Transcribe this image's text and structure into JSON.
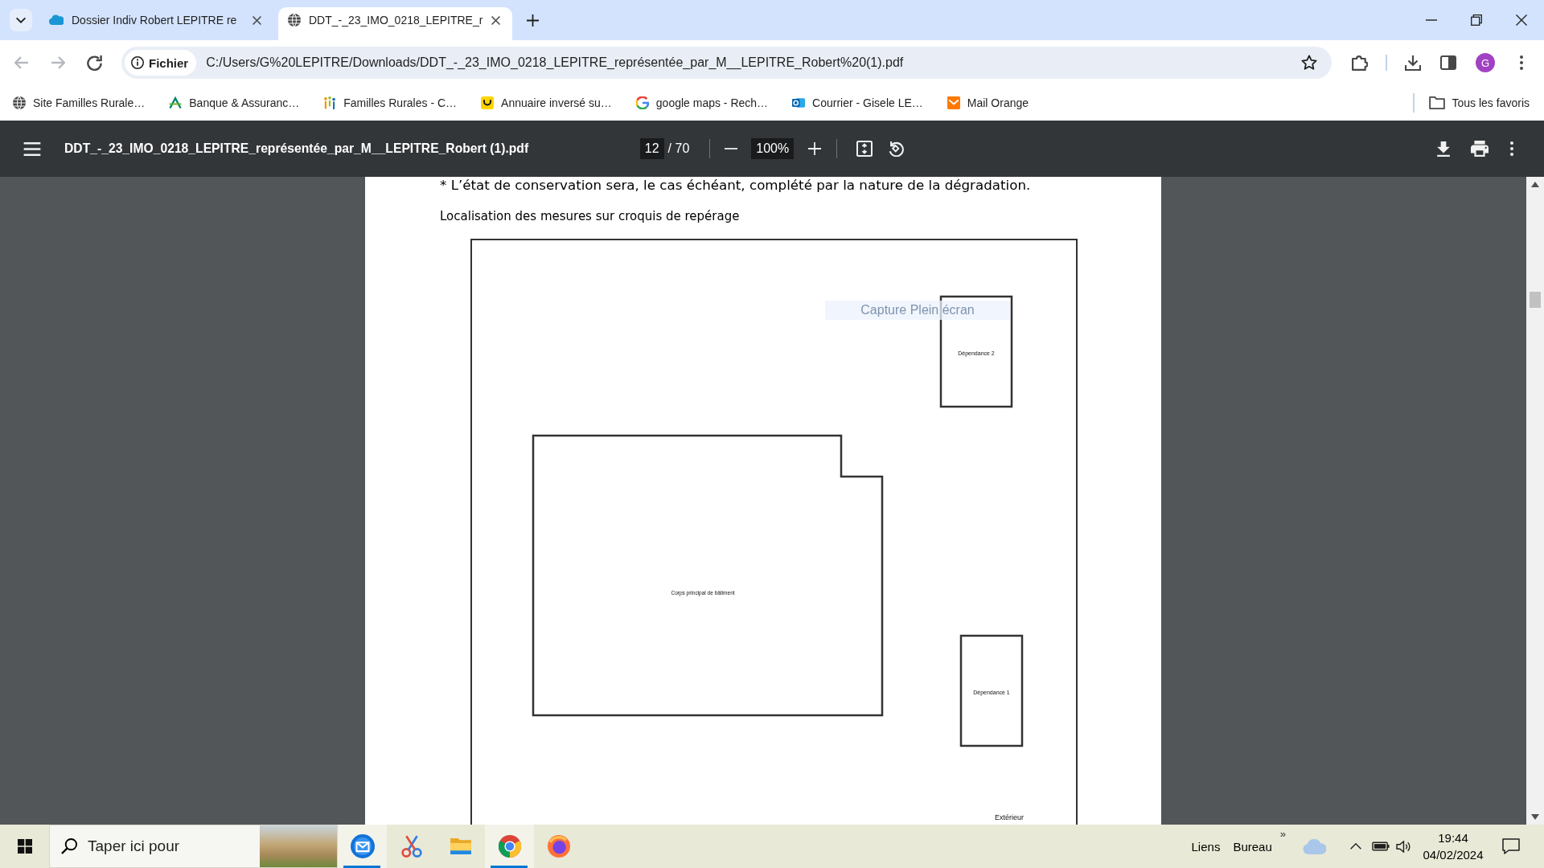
{
  "browser": {
    "tabs": [
      {
        "title": "Dossier Indiv Robert LEPITRE re",
        "selected": false
      },
      {
        "title": "DDT_-_23_IMO_0218_LEPITRE_r",
        "selected": true
      }
    ],
    "back": {
      "disabled": true
    },
    "forward": {
      "disabled": true
    },
    "address_bar": {
      "security_chip": "Fichier",
      "url": "C:/Users/G%20LEPITRE/Downloads/DDT_-_23_IMO_0218_LEPITRE_représentée_par_M__LEPITRE_Robert%20(1).pdf",
      "bookmarked": false
    },
    "profile_initial": "G",
    "bookmarks": [
      {
        "label": "Site Familles Rurale…"
      },
      {
        "label": "Banque & Assuranc…"
      },
      {
        "label": "Familles Rurales - C…"
      },
      {
        "label": "Annuaire inversé su…"
      },
      {
        "label": "google maps - Rech…"
      },
      {
        "label": "Courrier - Gisele LE…"
      },
      {
        "label": "Mail Orange"
      }
    ],
    "all_bookmarks": "Tous les favoris"
  },
  "pdf_viewer": {
    "title": "DDT_-_23_IMO_0218_LEPITRE_représentée_par_M__LEPITRE_Robert (1).pdf",
    "page": "12",
    "page_count": "/ 70",
    "zoom": "100%",
    "page_content": {
      "note": "* L’état de conservation sera, le cas échéant, complété par la nature de la dégradation.",
      "caption": "Localisation des mesures sur croquis de repérage",
      "sketch": {
        "buildings": [
          {
            "label": "Dépendance 2",
            "kind": "rect"
          },
          {
            "label": "Corps principal de bâtiment",
            "kind": "notched"
          },
          {
            "label": "Dépendance 1",
            "kind": "rect"
          }
        ],
        "exterior_label": "Extérieur"
      }
    }
  },
  "capture_tooltip": {
    "text": "Capture Plein écran"
  },
  "taskbar": {
    "search": {
      "placeholder": "Taper ici pour"
    },
    "apps": [
      {
        "active": true
      },
      {
        "active": false
      },
      {
        "active": false
      },
      {
        "active": true
      },
      {
        "active": false
      }
    ],
    "toolbars": [
      "Liens",
      "Bureau"
    ],
    "toolbar_overflow": "»",
    "time": "19:44",
    "date": "04/02/2024"
  }
}
